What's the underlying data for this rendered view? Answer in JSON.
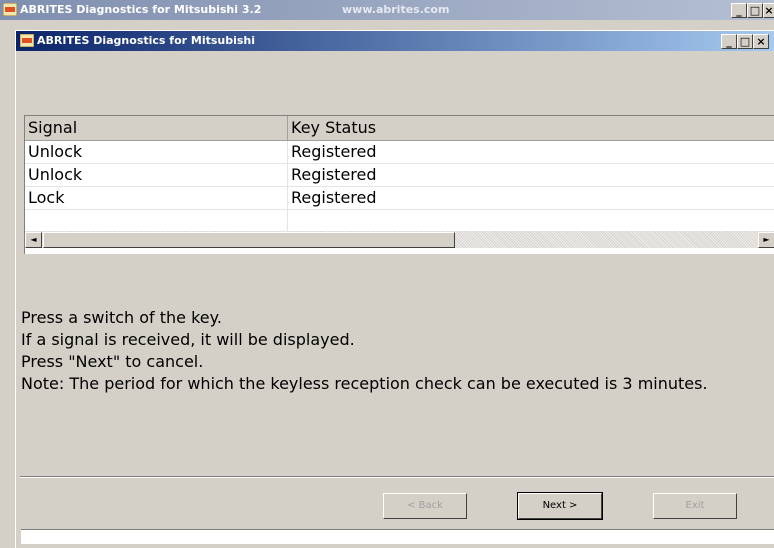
{
  "outer_window": {
    "title": "ABRITES Diagnostics for Mitsubishi 3.2",
    "url": "www.abrites.com",
    "minimize": "_",
    "restore": "□",
    "close": "×"
  },
  "inner_window": {
    "title": "ABRITES Diagnostics for Mitsubishi",
    "minimize": "_",
    "restore": "□",
    "close": "×"
  },
  "grid": {
    "columns": [
      "Signal",
      "Key Status"
    ],
    "rows": [
      [
        "Unlock",
        "Registered"
      ],
      [
        "Unlock",
        "Registered"
      ],
      [
        "Lock",
        "Registered"
      ],
      [
        "",
        ""
      ]
    ],
    "scroll_left": "◄",
    "scroll_right": "►"
  },
  "messages": [
    "Press a switch of the key.",
    "If a signal is received, it will be displayed.",
    "Press \"Next\" to cancel.",
    "Note: The period for which the keyless reception check can be executed is 3 minutes."
  ],
  "buttons": {
    "back": "< Back",
    "next": "Next >",
    "exit": "Exit"
  },
  "colors": {
    "inner_title_start": "#0a246a",
    "inner_title_end": "#a6caf0",
    "window_bg": "#d4d0c8"
  }
}
